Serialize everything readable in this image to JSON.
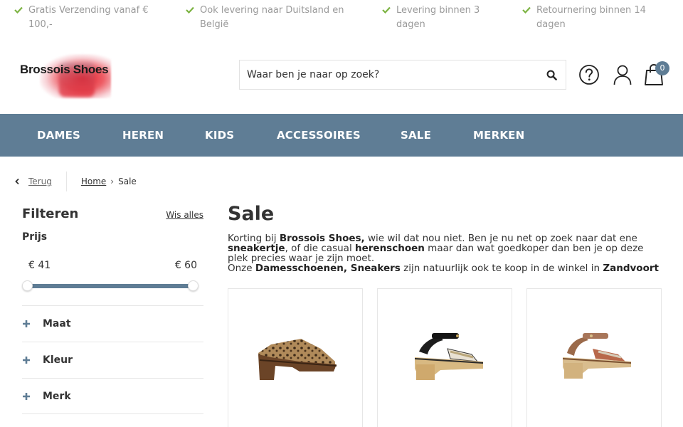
{
  "usps": [
    "Gratis Verzending vanaf € 100,-",
    "Ook levering naar Duitsland en België",
    "Levering binnen 3 dagen",
    "Retournering binnen 14 dagen"
  ],
  "colors": {
    "accent": "#5f7d95",
    "check": "#7cb342",
    "logo_red": "#e21d2a"
  },
  "logo": {
    "text": "Brossois Shoes"
  },
  "search": {
    "placeholder": "Waar ben je naar op zoek?"
  },
  "cart": {
    "count": "0"
  },
  "nav": [
    "DAMES",
    "HEREN",
    "KIDS",
    "ACCESSOIRES",
    "SALE",
    "MERKEN"
  ],
  "breadcrumb": {
    "back": "Terug",
    "home": "Home",
    "current": "Sale"
  },
  "filters": {
    "title": "Filteren",
    "clear": "Wis alles",
    "price_label": "Prijs",
    "price_min": "€ 41",
    "price_max": "€ 60",
    "facets": [
      "Maat",
      "Kleur",
      "Merk"
    ]
  },
  "main": {
    "title": "Sale",
    "intro": {
      "t1": "Korting bij ",
      "b1": "Brossois Shoes,",
      "t2": " wie wil dat nou niet. Ben je nu net op zoek naar dat ene ",
      "b2": "sneakertje",
      "t3": ", of die casual ",
      "b3": "herenschoen",
      "t4": " maar dan wat goedkoper dan ben je op deze plek precies waar je zijn moet.",
      "t5": "Onze ",
      "b4": "Damesschoenen, Sneakers",
      "t6": " zijn natuurlijk ook te koop in de winkel in ",
      "b5": "Zandvoort"
    }
  },
  "products": [
    {
      "image": "leopard-clog-sandal"
    },
    {
      "image": "black-strap-block-heel-sandal"
    },
    {
      "image": "brown-strap-block-heel-sandal"
    }
  ]
}
